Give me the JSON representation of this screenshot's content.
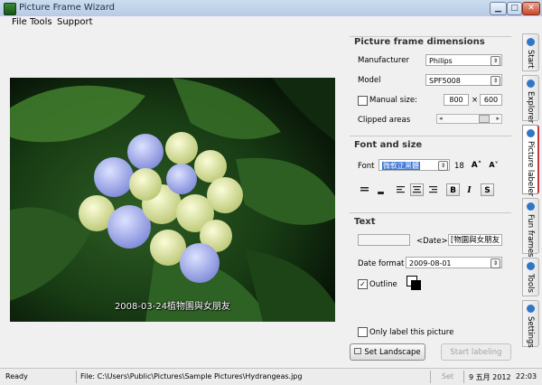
{
  "window": {
    "title": "Picture Frame Wizard",
    "minimize": "▁",
    "maximize": "□",
    "close": "✕"
  },
  "menu": [
    "File",
    "Tools",
    "Support"
  ],
  "photo": {
    "stamp": "2008-03-24植物園與女朋友"
  },
  "dimensions": {
    "heading": "Picture frame dimensions",
    "manufacturer_label": "Manufacturer",
    "manufacturer_value": "Philips",
    "model_label": "Model",
    "model_value": "SPF5008",
    "manual_size_label": "Manual size:",
    "width": "800",
    "times": "×",
    "height": "600",
    "clipped_label": "Clipped areas"
  },
  "font": {
    "heading": "Font and size",
    "font_label": "Font",
    "font_value": "微軟正黑體",
    "size": "18",
    "grow": "A˄",
    "shrink": "A˅",
    "bold": "B",
    "italic": "I",
    "shadow": "S"
  },
  "text": {
    "heading": "Text",
    "date_tag": "<Date>",
    "custom_text": "[物園與女朋友",
    "date_format_label": "Date format",
    "date_format_value": "2009-08-01",
    "outline_label": "Outline",
    "outline_checked": "✓"
  },
  "actions": {
    "only_label": "Only label this picture",
    "landscape": "Set Landscape",
    "start": "Start labeling"
  },
  "tabs": [
    "Start",
    "Explorer",
    "Picture labeler",
    "Fun frames",
    "Tools",
    "Settings"
  ],
  "status": {
    "state": "Ready",
    "file": "File: C:\\Users\\Public\\Pictures\\Sample Pictures\\Hydrangeas.jpg",
    "set": "Set",
    "date": "9 五月 2012",
    "time": "22:03"
  },
  "colors": {
    "accent": "#c53a3a",
    "tab_icon": "#2f77c6"
  }
}
